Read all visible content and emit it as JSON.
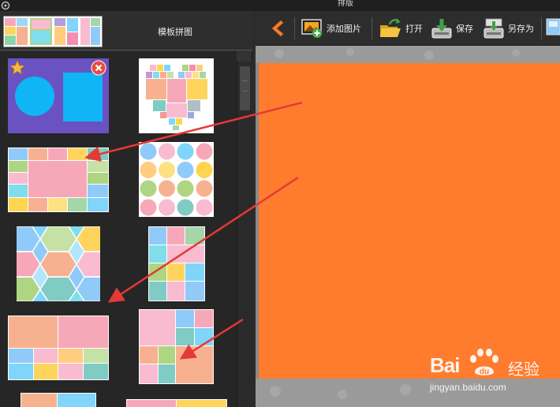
{
  "window": {
    "title": "排版"
  },
  "left_panel": {
    "header_label": "模板拼图"
  },
  "toolbar": {
    "add_image": "添加图片",
    "open": "打开",
    "save": "保存",
    "save_as": "另存为"
  },
  "watermark": {
    "brand": "Bai",
    "brand_cn": "经验",
    "url": "jingyan.baidu.com"
  },
  "colors": {
    "canvas": "#ff7c2e",
    "panel": "#333333",
    "arrow": "#e53935"
  }
}
